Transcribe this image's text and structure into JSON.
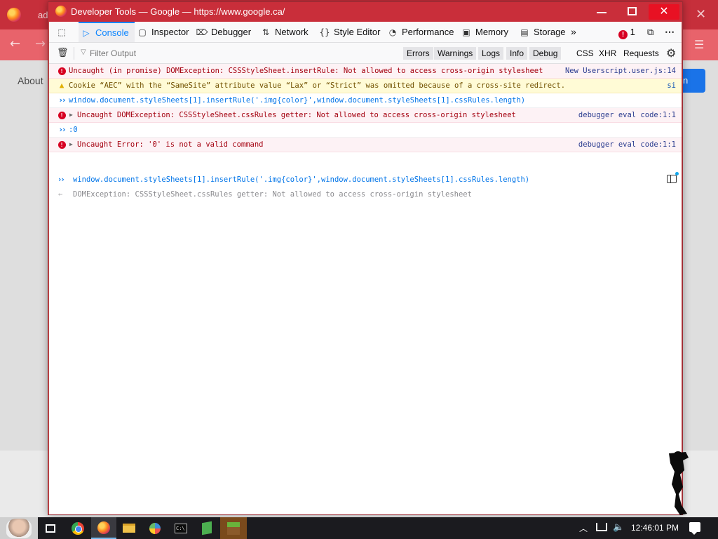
{
  "background_page": {
    "tab_fragment": "ad",
    "about_link": "About",
    "signin_fragment": "n"
  },
  "window": {
    "title": "Developer Tools — Google — https://www.google.ca/"
  },
  "toolbar": {
    "tabs": {
      "console": "Console",
      "inspector": "Inspector",
      "debugger": "Debugger",
      "network": "Network",
      "style_editor": "Style Editor",
      "performance": "Performance",
      "memory": "Memory",
      "storage": "Storage"
    },
    "error_count": "1"
  },
  "filterbar": {
    "filter_placeholder": "Filter Output",
    "levels": {
      "errors": "Errors",
      "warnings": "Warnings",
      "logs": "Logs",
      "info": "Info",
      "debug": "Debug"
    },
    "net": {
      "css": "CSS",
      "xhr": "XHR",
      "requests": "Requests"
    }
  },
  "console": {
    "messages": [
      {
        "type": "error",
        "text": "Uncaught (in promise) DOMException: CSSStyleSheet.insertRule: Not allowed to access cross-origin stylesheet",
        "source": "New Userscript.user.js:14"
      },
      {
        "type": "warn",
        "text": "Cookie “AEC” with the “SameSite” attribute value “Lax” or “Strict” was omitted because of a cross-site redirect.",
        "source": "si"
      },
      {
        "type": "input",
        "text": "window.document.styleSheets[1].insertRule('.img{color}',window.document.styleSheets[1].cssRules.length)"
      },
      {
        "type": "error",
        "text": "Uncaught DOMException: CSSStyleSheet.cssRules getter: Not allowed to access cross-origin stylesheet",
        "source": "debugger eval code:1:1"
      },
      {
        "type": "input",
        "text": ":0"
      },
      {
        "type": "error",
        "text": "Uncaught Error: '0' is not a valid command",
        "source": "debugger eval code:1:1"
      }
    ],
    "input_value": "window.document.styleSheets[1].insertRule('.img{color}',window.document.styleSheets[1].cssRules.length)",
    "eager_result": "DOMException: CSSStyleSheet.cssRules getter: Not allowed to access cross-origin stylesheet"
  },
  "taskbar": {
    "clock": "12:46:01 PM"
  },
  "colors": {
    "accent": "#0a84ff",
    "error_bg": "#fdf2f5",
    "error_text": "#a4000f",
    "warn_bg": "#fffbd6",
    "titlebar": "#c92e3a"
  }
}
